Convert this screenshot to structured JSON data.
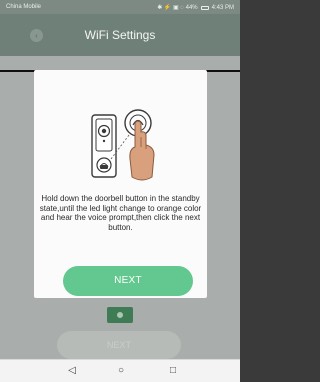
{
  "statusbar": {
    "carrier": "China Mobile",
    "indicators": "✱ ⚡ ▣ ◌ 44%",
    "time": "4:43 PM"
  },
  "header": {
    "title": "WiFi Settings",
    "back_icon": "chevron-left-icon"
  },
  "modal": {
    "instruction": "Hold down the doorbell button in the standby state,until the led light change to orange color and hear the voice prompt,then click the next button.",
    "next_label": "NEXT"
  },
  "background": {
    "next_label": "NEXT"
  },
  "navbar": {
    "back_icon": "◁",
    "home_icon": "○",
    "recent_icon": "□"
  },
  "colors": {
    "accent": "#62c88f",
    "header": "#6f8078"
  }
}
